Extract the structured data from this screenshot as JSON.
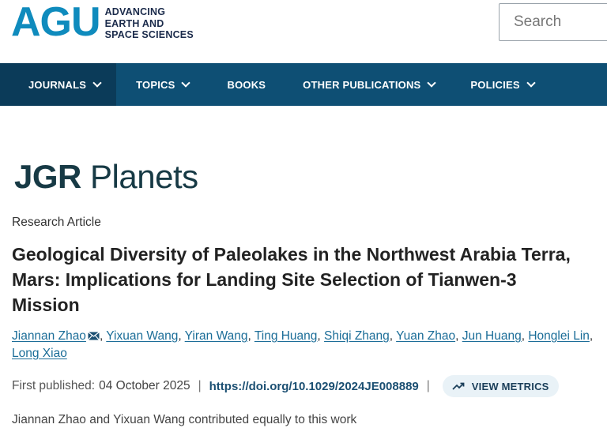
{
  "header": {
    "logo_mark": "AGU",
    "logo_lines": [
      "ADVANCING",
      "EARTH AND",
      "SPACE SCIENCES"
    ],
    "search_placeholder": "Search"
  },
  "nav": {
    "items": [
      {
        "label": "JOURNALS",
        "has_dropdown": true,
        "active": true
      },
      {
        "label": "TOPICS",
        "has_dropdown": true,
        "active": false
      },
      {
        "label": "BOOKS",
        "has_dropdown": false,
        "active": false
      },
      {
        "label": "OTHER PUBLICATIONS",
        "has_dropdown": true,
        "active": false
      },
      {
        "label": "POLICIES",
        "has_dropdown": true,
        "active": false
      }
    ]
  },
  "journal": {
    "name_a": "JGR",
    "name_b": "Planets"
  },
  "article": {
    "type": "Research Article",
    "title": "Geological Diversity of Paleolakes in the Northwest Arabia Terra, Mars: Implications for Landing Site Selection of Tianwen-3 Mission",
    "authors": [
      "Jiannan Zhao",
      "Yixuan Wang",
      "Yiran Wang",
      "Ting Huang",
      "Shiqi Zhang",
      "Yuan Zhao",
      "Jun Huang",
      "Honglei Lin",
      "Long Xiao"
    ],
    "first_published_label": "First published:",
    "first_published_date": "04 October 2025",
    "doi": "https://doi.org/10.1029/2024JE008889",
    "metrics_label": "VIEW METRICS",
    "note": "Jiannan Zhao and Yixuan Wang contributed equally to this work"
  },
  "colors": {
    "nav_bg": "#0e4f74",
    "nav_active_bg": "#0b3b59",
    "logo_blue": "#0f8bbd",
    "link": "#1b6d98"
  }
}
